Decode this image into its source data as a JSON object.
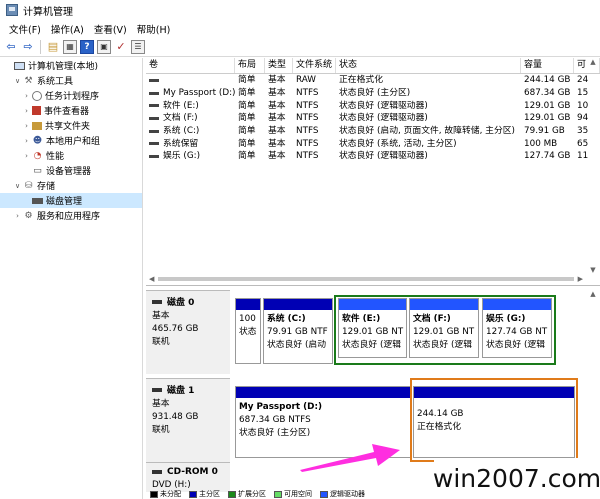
{
  "window": {
    "title": "计算机管理"
  },
  "menu": [
    "文件(F)",
    "操作(A)",
    "查看(V)",
    "帮助(H)"
  ],
  "toolbar_icons": [
    "back-arrow-icon",
    "forward-arrow-icon",
    "folder-up-icon",
    "properties-icon",
    "help-icon",
    "console-icon",
    "check-icon",
    "view-icon"
  ],
  "tree": [
    {
      "label": "计算机管理(本地)",
      "indent": 0,
      "exp": "",
      "icon": "computer-icon"
    },
    {
      "label": "系统工具",
      "indent": 1,
      "exp": "∨",
      "icon": "tools-icon"
    },
    {
      "label": "任务计划程序",
      "indent": 2,
      "exp": "›",
      "icon": "clock-icon"
    },
    {
      "label": "事件查看器",
      "indent": 2,
      "exp": "›",
      "icon": "event-log-icon"
    },
    {
      "label": "共享文件夹",
      "indent": 2,
      "exp": "›",
      "icon": "shared-folder-icon"
    },
    {
      "label": "本地用户和组",
      "indent": 2,
      "exp": "›",
      "icon": "users-icon"
    },
    {
      "label": "性能",
      "indent": 2,
      "exp": "›",
      "icon": "performance-icon"
    },
    {
      "label": "设备管理器",
      "indent": 2,
      "exp": "",
      "icon": "device-manager-icon"
    },
    {
      "label": "存储",
      "indent": 1,
      "exp": "∨",
      "icon": "storage-icon"
    },
    {
      "label": "磁盘管理",
      "indent": 2,
      "exp": "",
      "icon": "disk-icon",
      "selected": true
    },
    {
      "label": "服务和应用程序",
      "indent": 1,
      "exp": "›",
      "icon": "services-icon"
    }
  ],
  "volume_table": {
    "headers": [
      "卷",
      "布局",
      "类型",
      "文件系统",
      "状态",
      "容量",
      "可"
    ],
    "rows": [
      [
        "",
        "简单",
        "基本",
        "RAW",
        "正在格式化",
        "244.14 GB",
        "24"
      ],
      [
        "My Passport (D:)",
        "简单",
        "基本",
        "NTFS",
        "状态良好 (主分区)",
        "687.34 GB",
        "15"
      ],
      [
        "软件 (E:)",
        "简单",
        "基本",
        "NTFS",
        "状态良好 (逻辑驱动器)",
        "129.01 GB",
        "10"
      ],
      [
        "文档 (F:)",
        "简单",
        "基本",
        "NTFS",
        "状态良好 (逻辑驱动器)",
        "129.01 GB",
        "94"
      ],
      [
        "系统 (C:)",
        "简单",
        "基本",
        "NTFS",
        "状态良好 (启动, 页面文件, 故障转储, 主分区)",
        "79.91 GB",
        "35"
      ],
      [
        "系统保留",
        "简单",
        "基本",
        "NTFS",
        "状态良好 (系统, 活动, 主分区)",
        "100 MB",
        "65"
      ],
      [
        "娱乐 (G:)",
        "简单",
        "基本",
        "NTFS",
        "状态良好 (逻辑驱动器)",
        "127.74 GB",
        "11"
      ]
    ]
  },
  "disks": [
    {
      "name": "磁盘 0",
      "type": "基本",
      "size": "465.76 GB",
      "status": "联机",
      "partitions": [
        {
          "name": "",
          "size": "100",
          "status": "状态"
        },
        {
          "name": "系统  (C:)",
          "size": "79.91 GB NTF",
          "status": "状态良好 (启动"
        },
        {
          "name": "软件  (E:)",
          "size": "129.01 GB NT",
          "status": "状态良好 (逻辑"
        },
        {
          "name": "文档  (F:)",
          "size": "129.01 GB NT",
          "status": "状态良好 (逻辑"
        },
        {
          "name": "娱乐  (G:)",
          "size": "127.74 GB NT",
          "status": "状态良好 (逻辑"
        }
      ]
    },
    {
      "name": "磁盘 1",
      "type": "基本",
      "size": "931.48 GB",
      "status": "联机",
      "partitions": [
        {
          "name": "My Passport  (D:)",
          "size": "687.34 GB NTFS",
          "status": "状态良好 (主分区)"
        },
        {
          "name": "",
          "size": "244.14 GB",
          "status": "正在格式化"
        }
      ]
    },
    {
      "name": "CD-ROM 0",
      "type": "DVD (H:)"
    }
  ],
  "legend": [
    {
      "label": "未分配",
      "color": "#000000"
    },
    {
      "label": "主分区",
      "color": "#0000b4"
    },
    {
      "label": "扩展分区",
      "color": "#1a8a1a"
    },
    {
      "label": "可用空间",
      "color": "#66dd66"
    },
    {
      "label": "逻辑驱动器",
      "color": "#2255ff"
    }
  ],
  "watermark": "win2007.com",
  "colors": {
    "primary_partition": "#0000b4",
    "highlight_green": "#1a7a1a",
    "highlight_orange": "#e07b1a",
    "arrow": "#ff2ee0"
  }
}
